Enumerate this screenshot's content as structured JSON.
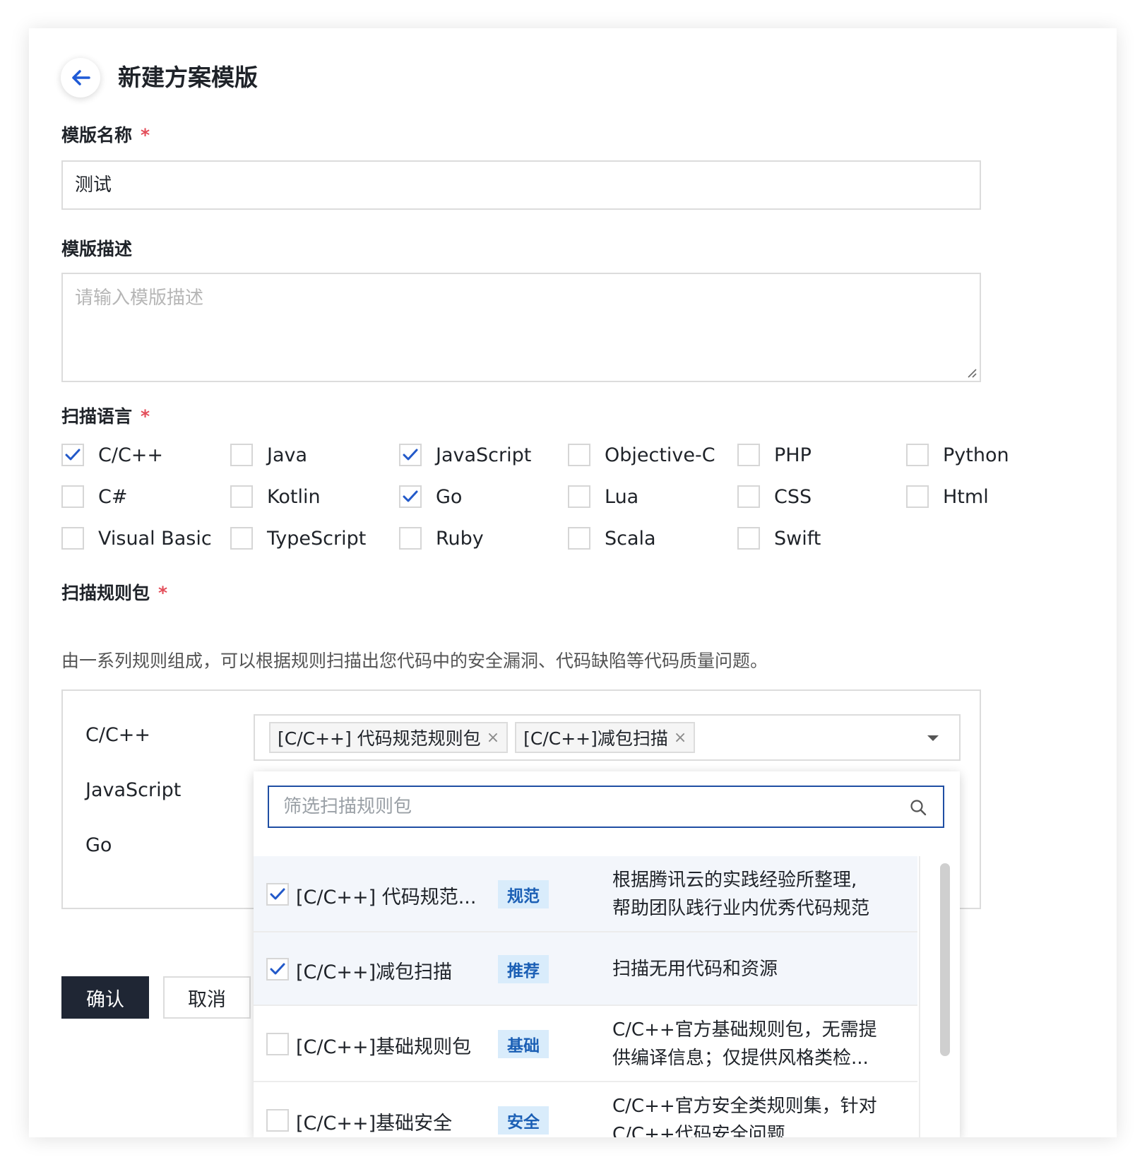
{
  "header": {
    "title": "新建方案模版"
  },
  "form": {
    "name_label": "模版名称",
    "name_value": "测试",
    "desc_label": "模版描述",
    "desc_placeholder": "请输入模版描述",
    "lang_label": "扫描语言",
    "rules_label": "扫描规则包",
    "rules_desc": "由一系列规则组成，可以根据规则扫描出您代码中的安全漏洞、代码缺陷等代码质量问题。",
    "required_mark": "*"
  },
  "languages": [
    {
      "name": "C/C++",
      "checked": true
    },
    {
      "name": "Java",
      "checked": false
    },
    {
      "name": "JavaScript",
      "checked": true
    },
    {
      "name": "Objective-C",
      "checked": false
    },
    {
      "name": "PHP",
      "checked": false
    },
    {
      "name": "Python",
      "checked": false
    },
    {
      "name": "C#",
      "checked": false
    },
    {
      "name": "Kotlin",
      "checked": false
    },
    {
      "name": "Go",
      "checked": true
    },
    {
      "name": "Lua",
      "checked": false
    },
    {
      "name": "CSS",
      "checked": false
    },
    {
      "name": "Html",
      "checked": false
    },
    {
      "name": "Visual Basic",
      "checked": false
    },
    {
      "name": "TypeScript",
      "checked": false
    },
    {
      "name": "Ruby",
      "checked": false
    },
    {
      "name": "Scala",
      "checked": false
    },
    {
      "name": "Swift",
      "checked": false
    }
  ],
  "rules": {
    "rows": [
      "C/C++",
      "JavaScript",
      "Go"
    ],
    "selected_tags": [
      "[C/C++] 代码规范规则包",
      "[C/C++]减包扫描"
    ],
    "tag_close": "×"
  },
  "dropdown": {
    "filter_placeholder": "筛选扫描规则包",
    "options": [
      {
        "name": "[C/C++] 代码规范...",
        "badge": "规范",
        "desc": [
          "根据腾讯云的实践经验所整理,",
          "帮助团队践行业内优秀代码规范"
        ],
        "checked": true
      },
      {
        "name": "[C/C++]减包扫描",
        "badge": "推荐",
        "desc": [
          "扫描无用代码和资源"
        ],
        "checked": true
      },
      {
        "name": "[C/C++]基础规则包",
        "badge": "基础",
        "desc": [
          "C/C++官方基础规则包，无需提",
          "供编译信息；仅提供风格类检..."
        ],
        "checked": false
      },
      {
        "name": "[C/C++]基础安全",
        "badge": "安全",
        "desc": [
          "C/C++官方安全类规则集，针对",
          "C/C++代码安全问题"
        ],
        "checked": false
      }
    ]
  },
  "actions": {
    "confirm": "确认",
    "cancel": "取消"
  },
  "colors": {
    "accent": "#1f4ea3",
    "check": "#2259c9",
    "required": "#e34d59",
    "primary_button": "#1f2634"
  }
}
